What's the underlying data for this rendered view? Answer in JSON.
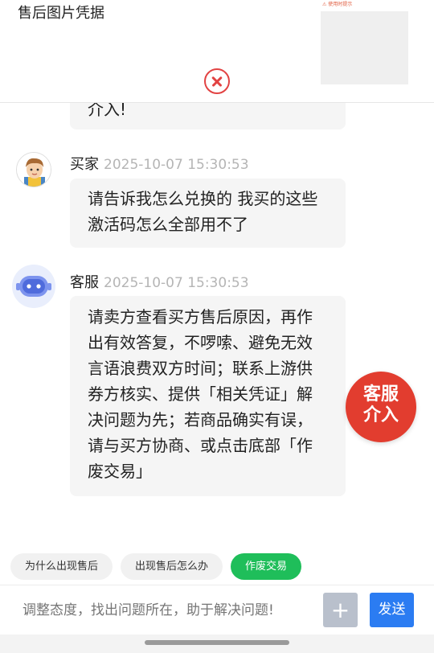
{
  "top": {
    "title": "售后图片凭据",
    "thumb_tag": "⚠ 使用时提示"
  },
  "messages": {
    "partial_text": "介入!",
    "buyer": {
      "name": "买家",
      "time": "2025-10-07 15:30:53",
      "text": "请告诉我怎么兑换的 我买的这些激活码怎么全部用不了"
    },
    "cs": {
      "name": "客服",
      "time": "2025-10-07 15:30:53",
      "text": "请卖方查看买方售后原因，再作出有效答复，不啰嗦、避免无效言语浪费双方时间；联系上游供券方核实、提供「相关凭证」解决问题为先；若商品确实有误，请与买方协商、或点击底部「作废交易」"
    }
  },
  "intervene": {
    "line1": "客服",
    "line2": "介入"
  },
  "quick_replies": [
    {
      "label": "为什么出现售后"
    },
    {
      "label": "出现售后怎么办"
    },
    {
      "label": "作废交易"
    }
  ],
  "input": {
    "placeholder": "调整态度，找出问题所在，助于解决问题!",
    "plus_label": "+",
    "send_label": "发送"
  },
  "colors": {
    "accent_blue": "#2b7cf2",
    "accent_green": "#1fbe5a",
    "accent_red": "#e23d2f"
  }
}
